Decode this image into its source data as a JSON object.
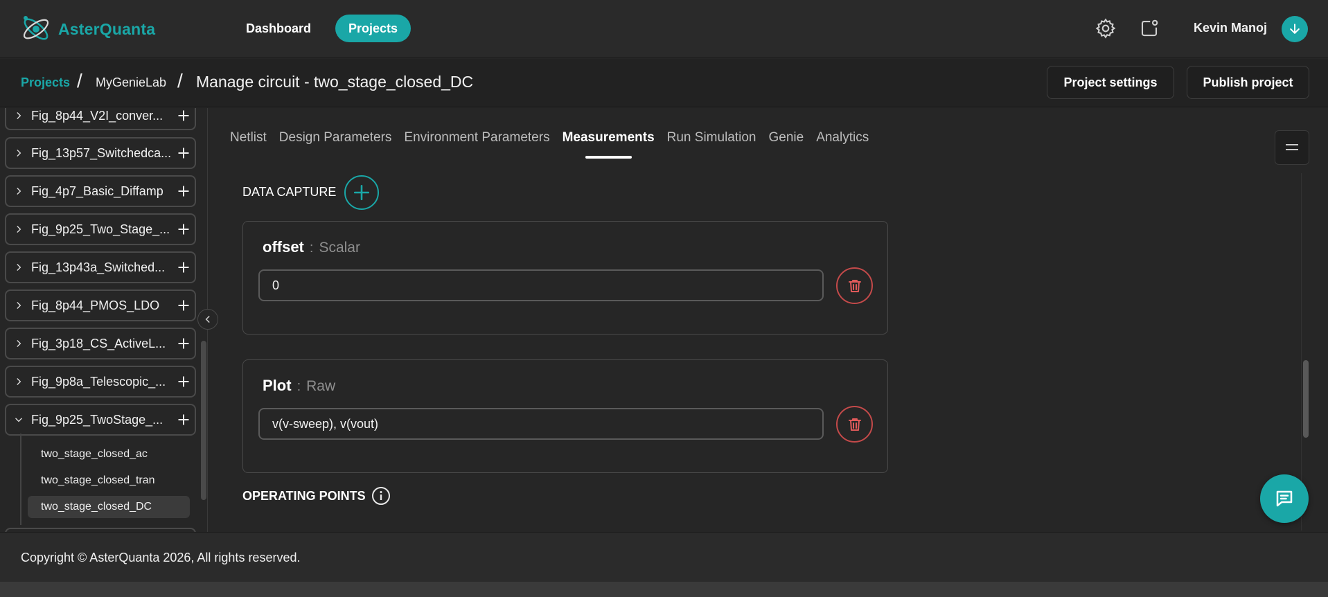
{
  "app": {
    "brand": "AsterQuanta",
    "accent": "#1aa7a7",
    "danger": "#c44a4a"
  },
  "nav": {
    "dashboard": "Dashboard",
    "projects": "Projects"
  },
  "header_icons": [
    "gear-icon",
    "notification-icon"
  ],
  "user": {
    "name": "Kevin Manoj",
    "avatar_icon": "arrow-down-icon"
  },
  "breadcrumb": {
    "root": "Projects",
    "sep": "/",
    "lab": "MyGenieLab",
    "title": "Manage circuit - two_stage_closed_DC"
  },
  "actions": {
    "project_settings": "Project settings",
    "publish": "Publish project"
  },
  "sidebar": {
    "projects": [
      {
        "name": "Fig_8p44_V2I_conver...",
        "expanded": false
      },
      {
        "name": "Fig_13p57_Switchedca...",
        "expanded": false
      },
      {
        "name": "Fig_4p7_Basic_Diffamp",
        "expanded": false
      },
      {
        "name": "Fig_9p25_Two_Stage_...",
        "expanded": false
      },
      {
        "name": "Fig_13p43a_Switched...",
        "expanded": false
      },
      {
        "name": "Fig_8p44_PMOS_LDO",
        "expanded": false
      },
      {
        "name": "Fig_3p18_CS_ActiveL...",
        "expanded": false
      },
      {
        "name": "Fig_9p8a_Telescopic_...",
        "expanded": false
      },
      {
        "name": "Fig_9p25_TwoStage_...",
        "expanded": true
      }
    ],
    "circuits": [
      {
        "name": "two_stage_closed_ac",
        "active": false
      },
      {
        "name": "two_stage_closed_tran",
        "active": false
      },
      {
        "name": "two_stage_closed_DC",
        "active": true
      }
    ]
  },
  "tabs": [
    {
      "label": "Netlist",
      "active": false
    },
    {
      "label": "Design Parameters",
      "active": false
    },
    {
      "label": "Environment Parameters",
      "active": false
    },
    {
      "label": "Measurements",
      "active": true
    },
    {
      "label": "Run Simulation",
      "active": false
    },
    {
      "label": "Genie",
      "active": false
    },
    {
      "label": "Analytics",
      "active": false
    }
  ],
  "data_capture": {
    "label": "DATA CAPTURE",
    "items": [
      {
        "name": "offset",
        "sep": ":",
        "type": "Scalar",
        "value": "0"
      },
      {
        "name": "Plot",
        "sep": ":",
        "type": "Raw",
        "value": "v(v-sweep), v(vout)"
      }
    ]
  },
  "operating_points": {
    "label": "OPERATING POINTS"
  },
  "footer": {
    "copyright": "Copyright © AsterQuanta 2026, All rights reserved."
  }
}
